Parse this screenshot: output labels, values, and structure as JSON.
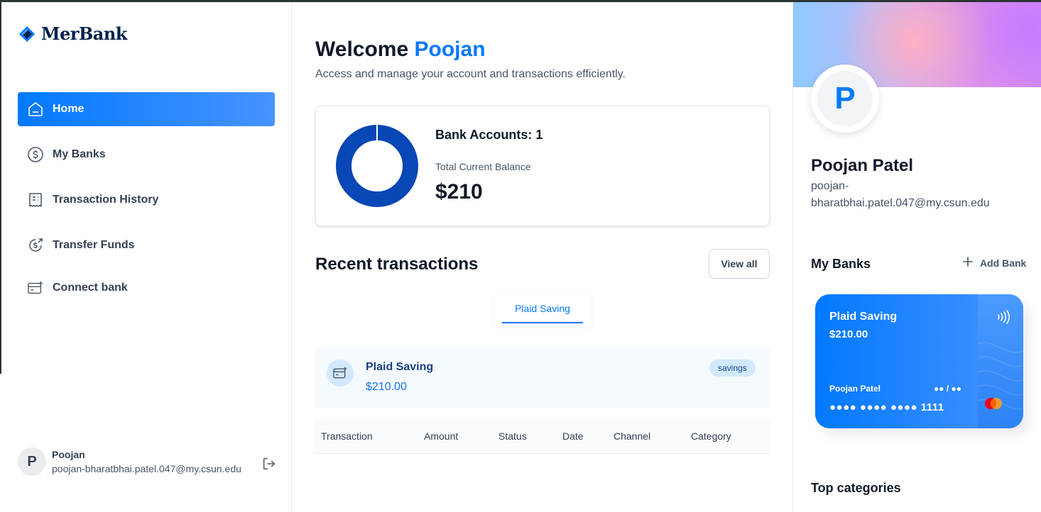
{
  "app": {
    "logo_text": "MerBank",
    "accent": "#0179fe"
  },
  "sidebar": {
    "items": [
      {
        "label": "Home",
        "icon": "home-icon",
        "active": true
      },
      {
        "label": "My Banks",
        "icon": "dollar-circle-icon",
        "active": false
      },
      {
        "label": "Transaction History",
        "icon": "receipt-icon",
        "active": false
      },
      {
        "label": "Transfer Funds",
        "icon": "money-send-icon",
        "active": false
      },
      {
        "label": "Connect bank",
        "icon": "connect-bank-icon",
        "active": false
      }
    ],
    "footer": {
      "avatar_letter": "P",
      "name": "Poojan",
      "email": "poojan-bharatbhai.patel.047@my.csun.edu",
      "logout_icon": "logout-icon"
    }
  },
  "header": {
    "welcome": "Welcome",
    "user_first_name": "Poojan",
    "subtitle": "Access and manage your account and transactions efficiently."
  },
  "balance": {
    "bank_accounts_label": "Bank Accounts: 1",
    "total_label": "Total Current Balance",
    "total_value": "$210",
    "donut_color": "#0747b6"
  },
  "recent": {
    "title": "Recent transactions",
    "view_all": "View all",
    "tabs": [
      "Plaid Saving"
    ],
    "bank_info": {
      "name": "Plaid Saving",
      "amount": "$210.00",
      "type": "savings"
    },
    "columns": [
      "Transaction",
      "Amount",
      "Status",
      "Date",
      "Channel",
      "Category"
    ]
  },
  "profile": {
    "avatar_letter": "P",
    "name": "Poojan Patel",
    "email": "poojan-bharatbhai.patel.047@my.csun.edu"
  },
  "my_banks": {
    "title": "My Banks",
    "add_bank": "Add Bank",
    "card": {
      "bank": "Plaid Saving",
      "balance": "$210.00",
      "holder": "Poojan Patel",
      "expiry": "●● / ●●",
      "number": "●●●● ●●●● ●●●● 1111"
    }
  },
  "top_categories": {
    "title": "Top categories"
  }
}
